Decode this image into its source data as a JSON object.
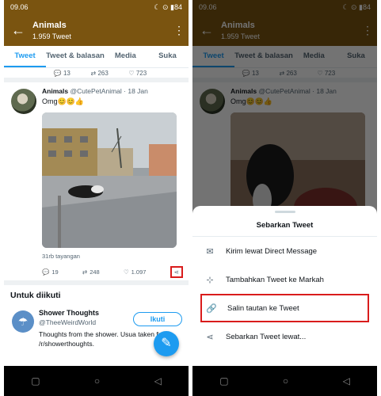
{
  "status": {
    "time": "09.06",
    "battery": "84"
  },
  "header": {
    "title": "Animals",
    "subtitle": "1.959 Tweet"
  },
  "tabs": [
    "Tweet",
    "Tweet & balasan",
    "Media",
    "Suka"
  ],
  "prev_counts": [
    "13",
    "263",
    "723"
  ],
  "tweet": {
    "name": "Animals",
    "handle": "@CutePetAnimal",
    "date": "· 18 Jan",
    "text": "Omg😊😊👍",
    "views": "31rb tayangan",
    "replies": "19",
    "retweets": "248",
    "likes": "1.097"
  },
  "suggest": {
    "section_title": "Untuk diikuti",
    "name": "Shower Thoughts",
    "handle": "@TheeWeirdWorld",
    "desc": "Thoughts from the shower. Usua taken from /r/showerthoughts.",
    "follow_label": "Ikuti"
  },
  "share_sheet": {
    "title": "Sebarkan Tweet",
    "options": [
      {
        "label": "Kirim lewat Direct Message",
        "icon": "mail-icon"
      },
      {
        "label": "Tambahkan Tweet ke Markah",
        "icon": "bookmark-icon"
      },
      {
        "label": "Salin tautan ke Tweet",
        "icon": "link-icon"
      },
      {
        "label": "Sebarkan Tweet lewat...",
        "icon": "share-icon"
      }
    ]
  },
  "colors": {
    "header": "#7a5410",
    "accent": "#1d9bf0",
    "highlight": "#d91c1c"
  }
}
